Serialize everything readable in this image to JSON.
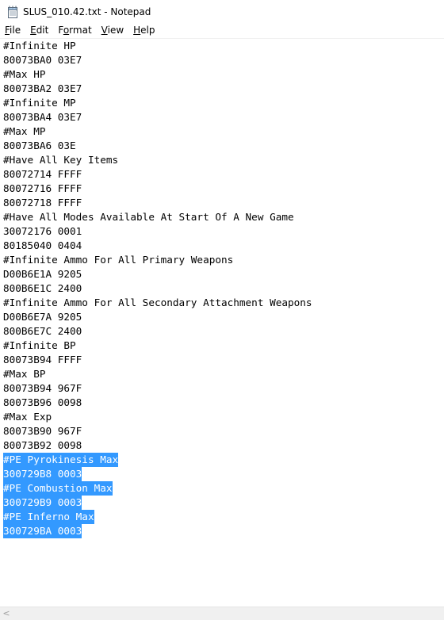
{
  "window": {
    "title": "SLUS_010.42.txt - Notepad",
    "icon": "notepad-icon"
  },
  "menu": [
    {
      "label": "File",
      "mnemonic": "F"
    },
    {
      "label": "Edit",
      "mnemonic": "E"
    },
    {
      "label": "Format",
      "mnemonic": "o"
    },
    {
      "label": "View",
      "mnemonic": "V"
    },
    {
      "label": "Help",
      "mnemonic": "H"
    }
  ],
  "editor": {
    "selection_color": "#3399ff",
    "lines": [
      {
        "text": "#Infinite HP",
        "selected": false
      },
      {
        "text": "80073BA0 03E7",
        "selected": false
      },
      {
        "text": "#Max HP",
        "selected": false
      },
      {
        "text": "80073BA2 03E7",
        "selected": false
      },
      {
        "text": "#Infinite MP",
        "selected": false
      },
      {
        "text": "80073BA4 03E7",
        "selected": false
      },
      {
        "text": "#Max MP",
        "selected": false
      },
      {
        "text": "80073BA6 03E",
        "selected": false
      },
      {
        "text": "#Have All Key Items",
        "selected": false
      },
      {
        "text": "80072714 FFFF",
        "selected": false
      },
      {
        "text": "80072716 FFFF",
        "selected": false
      },
      {
        "text": "80072718 FFFF",
        "selected": false
      },
      {
        "text": "#Have All Modes Available At Start Of A New Game",
        "selected": false
      },
      {
        "text": "30072176 0001",
        "selected": false
      },
      {
        "text": "80185040 0404",
        "selected": false
      },
      {
        "text": "#Infinite Ammo For All Primary Weapons",
        "selected": false
      },
      {
        "text": "D00B6E1A 9205",
        "selected": false
      },
      {
        "text": "800B6E1C 2400",
        "selected": false
      },
      {
        "text": "#Infinite Ammo For All Secondary Attachment Weapons",
        "selected": false
      },
      {
        "text": "D00B6E7A 9205",
        "selected": false
      },
      {
        "text": "800B6E7C 2400",
        "selected": false
      },
      {
        "text": "#Infinite BP",
        "selected": false
      },
      {
        "text": "80073B94 FFFF",
        "selected": false
      },
      {
        "text": "#Max BP",
        "selected": false
      },
      {
        "text": "80073B94 967F",
        "selected": false
      },
      {
        "text": "80073B96 0098",
        "selected": false
      },
      {
        "text": "#Max Exp",
        "selected": false
      },
      {
        "text": "80073B90 967F",
        "selected": false
      },
      {
        "text": "80073B92 0098",
        "selected": false
      },
      {
        "text": "#PE Pyrokinesis Max",
        "selected": true
      },
      {
        "text": "300729B8 0003",
        "selected": true
      },
      {
        "text": "#PE Combustion Max",
        "selected": true
      },
      {
        "text": "300729B9 0003",
        "selected": true
      },
      {
        "text": "#PE Inferno Max",
        "selected": true
      },
      {
        "text": "300729BA 0003",
        "selected": true
      }
    ]
  },
  "scrollbar": {
    "left_arrow": "<"
  }
}
